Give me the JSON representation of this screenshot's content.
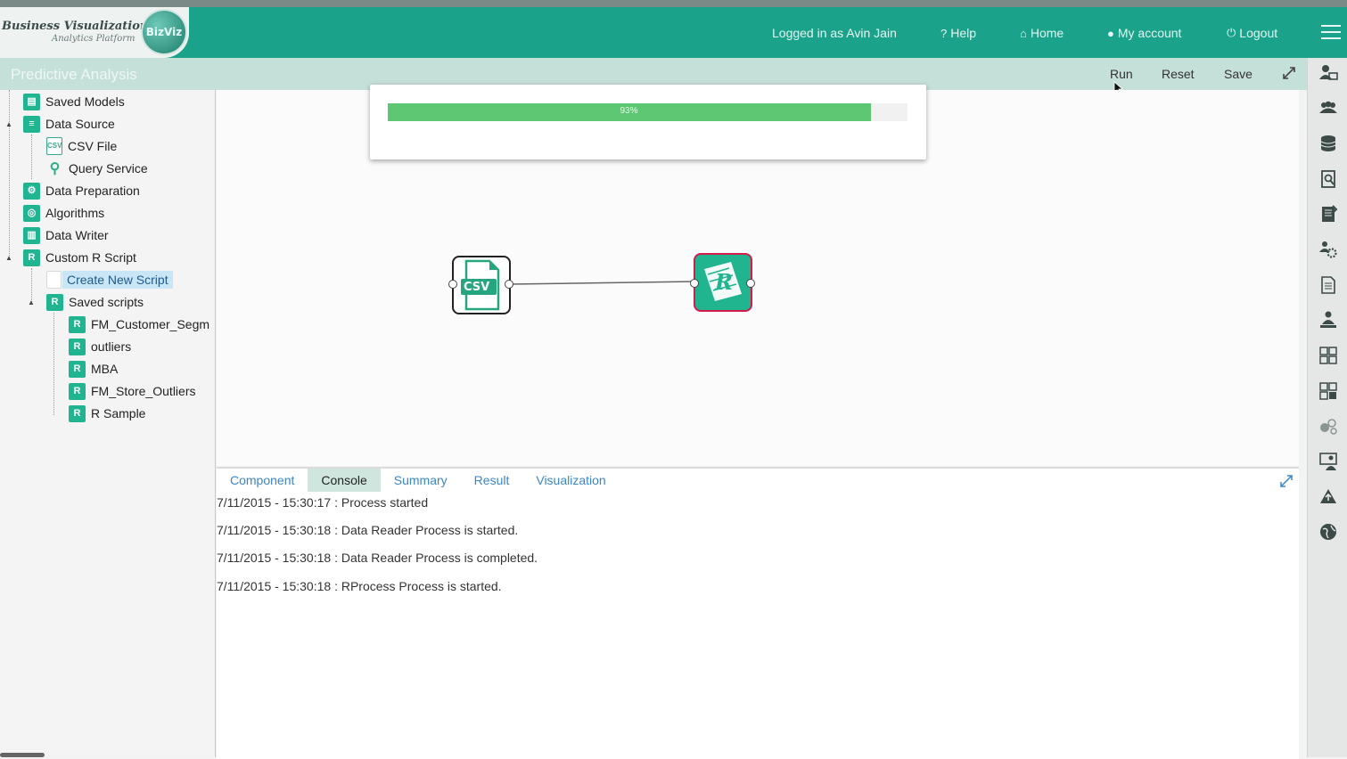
{
  "header": {
    "logo_line1": "Business Visualization",
    "logo_line2": "Analytics Platform",
    "logo_badge": "BizViz",
    "logged_in": "Logged in as Avin Jain",
    "help": "Help",
    "home": "Home",
    "my_account": "My account",
    "logout": "Logout"
  },
  "titlebar": {
    "title": "Predictive Analysis",
    "run": "Run",
    "reset": "Reset",
    "save": "Save"
  },
  "tree": {
    "saved_models": "Saved Models",
    "data_source": "Data Source",
    "csv_file": "CSV File",
    "query_service": "Query Service",
    "data_preparation": "Data Preparation",
    "algorithms": "Algorithms",
    "data_writer": "Data Writer",
    "custom_r_script": "Custom R Script",
    "create_new_script": "Create New Script",
    "saved_scripts": "Saved scripts",
    "scripts": [
      "FM_Customer_Segm",
      "outliers",
      "MBA",
      "FM_Store_Outliers",
      "R Sample"
    ]
  },
  "progress": {
    "label": "93%",
    "value": 0.93
  },
  "canvas": {
    "csv_node_label": "CSV",
    "r_node_label": "R"
  },
  "bottom": {
    "tabs": [
      "Component",
      "Console",
      "Summary",
      "Result",
      "Visualization"
    ],
    "active_tab": "Console",
    "log": [
      "7/11/2015 - 15:30:17 : Process started",
      "7/11/2015 - 15:30:18 : Data Reader Process is started.",
      "7/11/2015 - 15:30:18 : Data Reader Process is completed.",
      "7/11/2015 - 15:30:18 : RProcess Process is started."
    ]
  },
  "colors": {
    "header": "#1aa38a",
    "titlebar": "#c5dfd9",
    "progress": "#5ec773",
    "accent": "#21b490",
    "r_node_border": "#d21c4a"
  },
  "icons": {
    "right_toolbar": [
      "user-monitor-icon",
      "group-icon",
      "database-icon",
      "report-search-icon",
      "notebook-icon",
      "user-settings-icon",
      "document-icon",
      "person-icon",
      "grid-chart-icon",
      "dashboard-grid-icon",
      "circles-icon",
      "presenter-icon",
      "cloud-upload-icon",
      "globe-icon"
    ]
  }
}
